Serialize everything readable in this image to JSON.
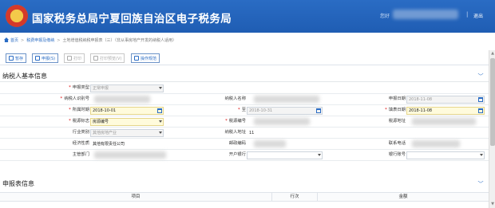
{
  "header": {
    "title": "国家税务总局宁夏回族自治区电子税务局",
    "welcome": "您好",
    "logout": "退出"
  },
  "breadcrumb": {
    "home": "首页",
    "level1": "税费申报及缴纳",
    "current": "土地增值税纳税申报表（三）（非从事房地产开发的纳税人适用）"
  },
  "toolbar": {
    "save": "暂存",
    "declare": "申报(S)",
    "print": "打印",
    "print_preview": "打印预览(V)",
    "help": "操作规范"
  },
  "sections": {
    "basic_info": "纳税人基本信息",
    "report_info": "申报表信息"
  },
  "form": {
    "declare_type_label": "申报类型",
    "declare_type_value": "正常申报",
    "taxpayer_id_label": "纳税人识别号",
    "taxpayer_name_label": "纳税人名称",
    "declare_date_label": "申报日期",
    "declare_date_value": "2018-11-08",
    "period_start_label": "所属时期",
    "period_start_value": "2018-10-01",
    "period_to_label": "至",
    "period_end_value": "2018-10-31",
    "fill_date_label": "填表日期",
    "fill_date_value": "2018-11-08",
    "tax_item_label": "税源标志",
    "tax_item_value": "房源编号",
    "tax_source_no_label": "税源编号",
    "tax_address_label": "税源地址",
    "industry_label": "行业类别",
    "industry_value": "其他房地产业",
    "taxpayer_addr_label": "纳税人地址",
    "taxpayer_addr_value": "11",
    "econ_nature_label": "经济性质",
    "econ_nature_value": "其他有限责任公司",
    "postcode_label": "邮政编码",
    "phone_label": "联系电话",
    "authority_label": "主管部门",
    "bank_label": "开户银行",
    "account_label": "银行账号"
  },
  "table": {
    "col_item": "项目",
    "col_line": "行次",
    "col_amount": "金额"
  }
}
